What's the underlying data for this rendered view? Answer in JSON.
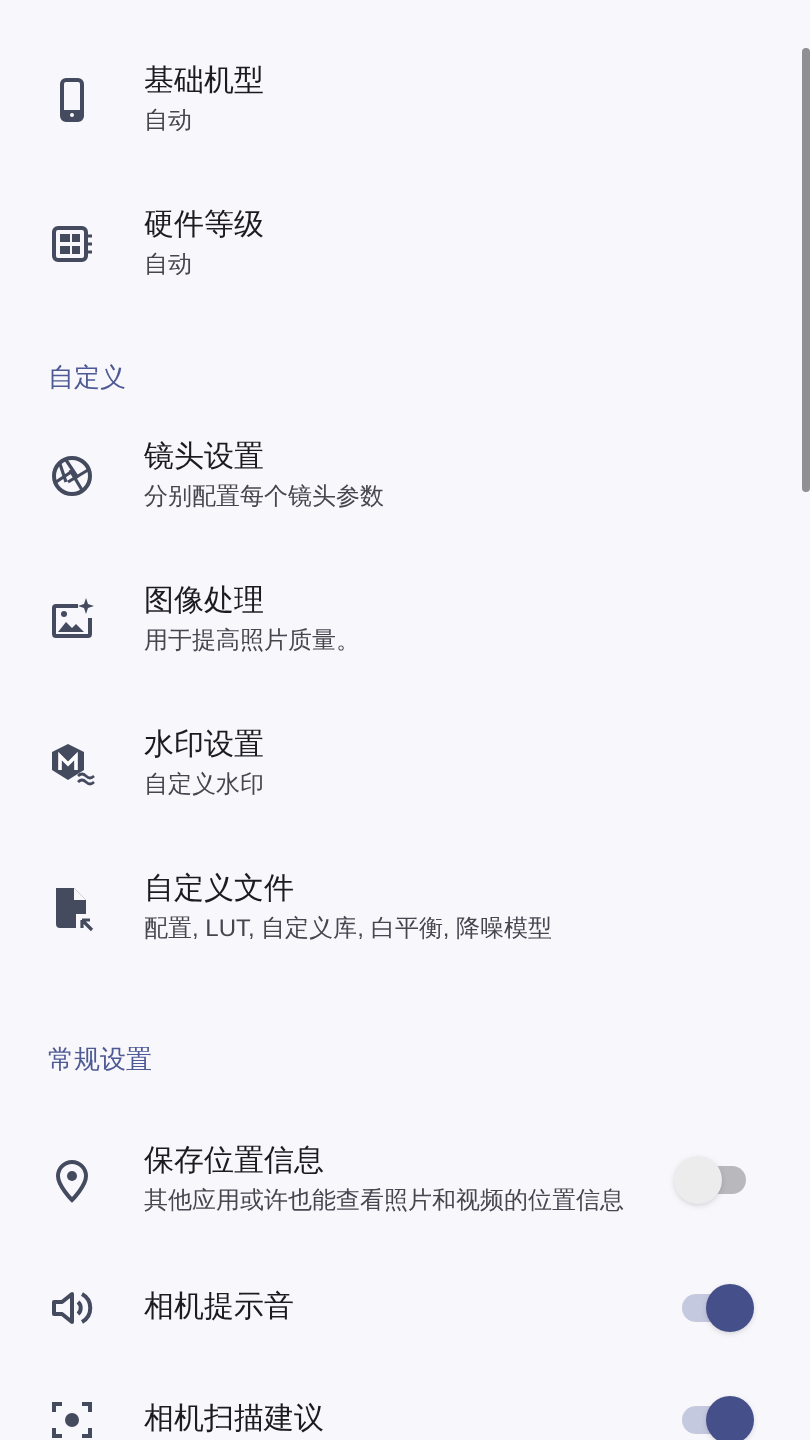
{
  "sections": [
    {
      "items": [
        {
          "kind": "link",
          "title": "基础机型",
          "subtitle": "自动"
        },
        {
          "kind": "link",
          "title": "硬件等级",
          "subtitle": "自动"
        }
      ]
    },
    {
      "header": "自定义",
      "items": [
        {
          "kind": "link",
          "title": "镜头设置",
          "subtitle": "分别配置每个镜头参数"
        },
        {
          "kind": "link",
          "title": "图像处理",
          "subtitle": "用于提高照片质量。"
        },
        {
          "kind": "link",
          "title": "水印设置",
          "subtitle": "自定义水印"
        },
        {
          "kind": "link",
          "title": "自定义文件",
          "subtitle": "配置, LUT, 自定义库, 白平衡, 降噪模型"
        }
      ]
    },
    {
      "header": "常规设置",
      "items": [
        {
          "kind": "switch",
          "title": "保存位置信息",
          "subtitle": "其他应用或许也能查看照片和视频的位置信息",
          "on": false
        },
        {
          "kind": "switch",
          "title": "相机提示音",
          "on": true
        },
        {
          "kind": "switch",
          "title": "相机扫描建议",
          "on": true
        }
      ]
    }
  ]
}
